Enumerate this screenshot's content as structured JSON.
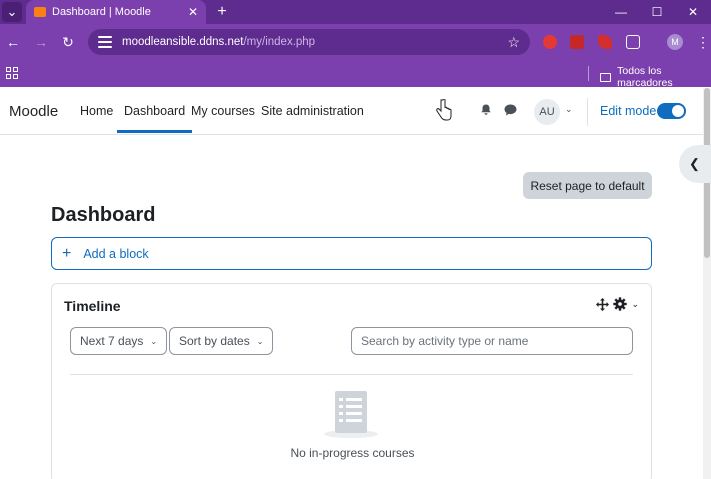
{
  "browser": {
    "tab_title": "Dashboard | Moodle",
    "url_host": "moodleansible.ddns.net",
    "url_path": "/my/index.php",
    "bookmarks_folder": "Todos los marcadores",
    "profile_initial": "M"
  },
  "navbar": {
    "brand": "Moodle",
    "links": [
      "Home",
      "Dashboard",
      "My courses",
      "Site administration"
    ],
    "active_link": "Dashboard",
    "avatar_initials": "AU",
    "edit_mode_label": "Edit mode",
    "edit_mode_on": true
  },
  "page": {
    "reset_button": "Reset page to default",
    "title": "Dashboard",
    "add_block": "Add a block"
  },
  "timeline": {
    "title": "Timeline",
    "filter_days": "Next 7 days",
    "sort": "Sort by dates",
    "search_placeholder": "Search by activity type or name",
    "empty_message": "No in-progress courses"
  },
  "colors": {
    "browser_frame": "#7b3fae",
    "accent": "#0f6cbf"
  }
}
